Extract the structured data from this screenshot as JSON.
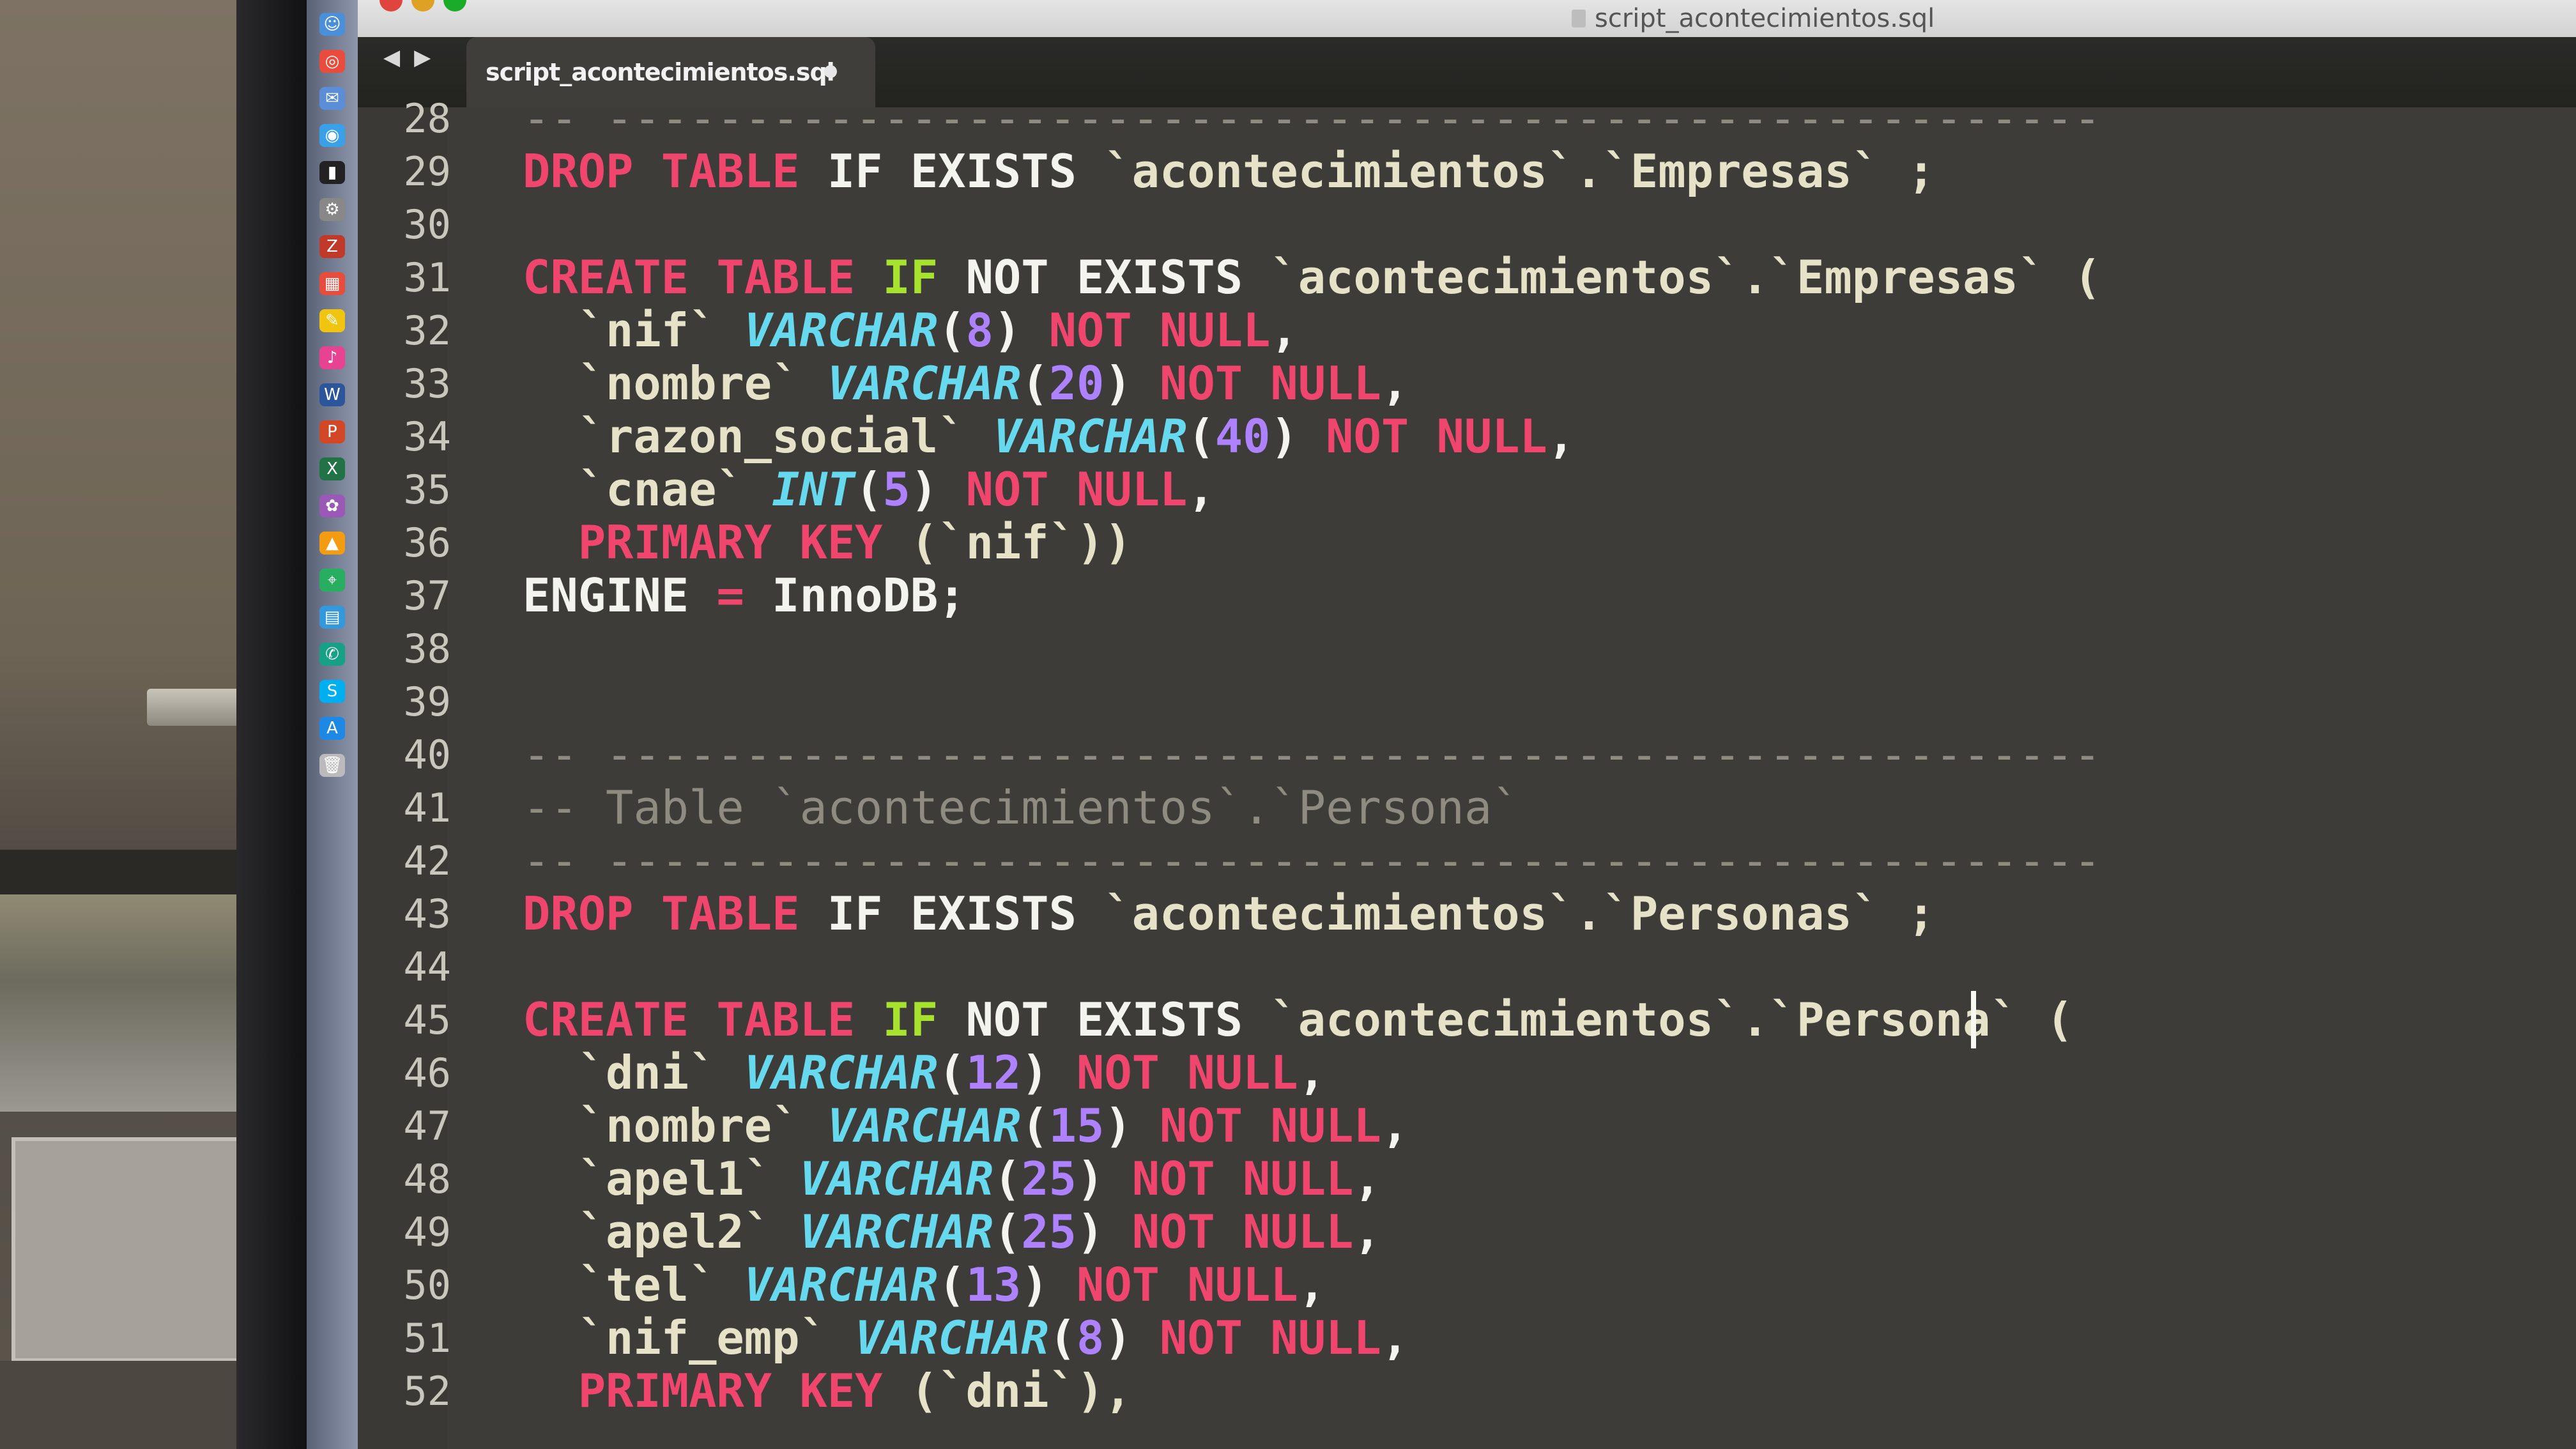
{
  "window": {
    "title": "script_acontecimientos.sql"
  },
  "tabs": [
    {
      "label": "script_acontecimientos.sql",
      "modified": true
    }
  ],
  "nav": {
    "back": "◀",
    "forward": "▶"
  },
  "colors": {
    "keyword_red": "#f0466e",
    "keyword_green": "#a6e22e",
    "type_blue": "#66d9ef",
    "number_purple": "#ae81ff",
    "comment_gray": "#8f8b80",
    "editor_bg": "#3d3c39"
  },
  "dock_icons": [
    "finder-icon",
    "chrome-icon",
    "mail-icon",
    "safari-icon",
    "terminal-icon",
    "settings-icon",
    "filezilla-icon",
    "calendar-icon",
    "notes-icon",
    "music-icon",
    "word-icon",
    "powerpoint-icon",
    "excel-icon",
    "photos-icon",
    "vlc-icon",
    "maps-icon",
    "files-icon",
    "chat-icon",
    "skype-icon",
    "app-store-icon",
    "trash-icon"
  ],
  "code_lines": [
    {
      "num": "28",
      "tokens": [
        {
          "t": "-- ------------------------------------------------------",
          "c": "comment"
        }
      ]
    },
    {
      "num": "29",
      "tokens": [
        {
          "t": "DROP TABLE ",
          "c": "kw-red"
        },
        {
          "t": "IF EXISTS ",
          "c": "kw-white"
        },
        {
          "t": "`acontecimientos`.`Empresas` ;",
          "c": "str-ident"
        }
      ]
    },
    {
      "num": "30",
      "tokens": []
    },
    {
      "num": "31",
      "tokens": [
        {
          "t": "CREATE TABLE ",
          "c": "kw-red"
        },
        {
          "t": "IF ",
          "c": "kw-green"
        },
        {
          "t": "NOT EXISTS ",
          "c": "kw-white"
        },
        {
          "t": "`acontecimientos`.`Empresas` (",
          "c": "str-ident"
        }
      ]
    },
    {
      "num": "32",
      "tokens": [
        {
          "t": "  `nif` ",
          "c": "str-ident"
        },
        {
          "t": "VARCHAR",
          "c": "type-blue"
        },
        {
          "t": "(",
          "c": "kw-white"
        },
        {
          "t": "8",
          "c": "num-purple"
        },
        {
          "t": ") ",
          "c": "kw-white"
        },
        {
          "t": "NOT NULL",
          "c": "kw-red"
        },
        {
          "t": ",",
          "c": "kw-white"
        }
      ]
    },
    {
      "num": "33",
      "tokens": [
        {
          "t": "  `nombre` ",
          "c": "str-ident"
        },
        {
          "t": "VARCHAR",
          "c": "type-blue"
        },
        {
          "t": "(",
          "c": "kw-white"
        },
        {
          "t": "20",
          "c": "num-purple"
        },
        {
          "t": ") ",
          "c": "kw-white"
        },
        {
          "t": "NOT NULL",
          "c": "kw-red"
        },
        {
          "t": ",",
          "c": "kw-white"
        }
      ]
    },
    {
      "num": "34",
      "tokens": [
        {
          "t": "  `razon_social` ",
          "c": "str-ident"
        },
        {
          "t": "VARCHAR",
          "c": "type-blue"
        },
        {
          "t": "(",
          "c": "kw-white"
        },
        {
          "t": "40",
          "c": "num-purple"
        },
        {
          "t": ") ",
          "c": "kw-white"
        },
        {
          "t": "NOT NULL",
          "c": "kw-red"
        },
        {
          "t": ",",
          "c": "kw-white"
        }
      ]
    },
    {
      "num": "35",
      "tokens": [
        {
          "t": "  `cnae` ",
          "c": "str-ident"
        },
        {
          "t": "INT",
          "c": "type-blue"
        },
        {
          "t": "(",
          "c": "kw-white"
        },
        {
          "t": "5",
          "c": "num-purple"
        },
        {
          "t": ") ",
          "c": "kw-white"
        },
        {
          "t": "NOT NULL",
          "c": "kw-red"
        },
        {
          "t": ",",
          "c": "kw-white"
        }
      ]
    },
    {
      "num": "36",
      "tokens": [
        {
          "t": "  PRIMARY KEY ",
          "c": "kw-red"
        },
        {
          "t": "(`nif`))",
          "c": "str-ident"
        }
      ]
    },
    {
      "num": "37",
      "tokens": [
        {
          "t": "ENGINE ",
          "c": "kw-white"
        },
        {
          "t": "= ",
          "c": "kw-red"
        },
        {
          "t": "InnoDB;",
          "c": "kw-white"
        }
      ]
    },
    {
      "num": "38",
      "tokens": []
    },
    {
      "num": "39",
      "tokens": []
    },
    {
      "num": "40",
      "tokens": [
        {
          "t": "-- ------------------------------------------------------",
          "c": "comment"
        }
      ]
    },
    {
      "num": "41",
      "tokens": [
        {
          "t": "-- Table `acontecimientos`.`Persona`",
          "c": "comment"
        }
      ]
    },
    {
      "num": "42",
      "tokens": [
        {
          "t": "-- ------------------------------------------------------",
          "c": "comment"
        }
      ]
    },
    {
      "num": "43",
      "tokens": [
        {
          "t": "DROP TABLE ",
          "c": "kw-red"
        },
        {
          "t": "IF EXISTS ",
          "c": "kw-white"
        },
        {
          "t": "`acontecimientos`.`Personas` ;",
          "c": "str-ident"
        }
      ]
    },
    {
      "num": "44",
      "tokens": []
    },
    {
      "num": "45",
      "tokens": [
        {
          "t": "CREATE TABLE ",
          "c": "kw-red"
        },
        {
          "t": "IF ",
          "c": "kw-green"
        },
        {
          "t": "NOT EXISTS ",
          "c": "kw-white"
        },
        {
          "t": "`acontecimientos`.`Persona` (",
          "c": "str-ident"
        }
      ]
    },
    {
      "num": "46",
      "tokens": [
        {
          "t": "  `dni` ",
          "c": "str-ident"
        },
        {
          "t": "VARCHAR",
          "c": "type-blue"
        },
        {
          "t": "(",
          "c": "kw-white"
        },
        {
          "t": "12",
          "c": "num-purple"
        },
        {
          "t": ") ",
          "c": "kw-white"
        },
        {
          "t": "NOT NULL",
          "c": "kw-red"
        },
        {
          "t": ",",
          "c": "kw-white"
        }
      ]
    },
    {
      "num": "47",
      "tokens": [
        {
          "t": "  `nombre` ",
          "c": "str-ident"
        },
        {
          "t": "VARCHAR",
          "c": "type-blue"
        },
        {
          "t": "(",
          "c": "kw-white"
        },
        {
          "t": "15",
          "c": "num-purple"
        },
        {
          "t": ") ",
          "c": "kw-white"
        },
        {
          "t": "NOT NULL",
          "c": "kw-red"
        },
        {
          "t": ",",
          "c": "kw-white"
        }
      ]
    },
    {
      "num": "48",
      "tokens": [
        {
          "t": "  `apel1` ",
          "c": "str-ident"
        },
        {
          "t": "VARCHAR",
          "c": "type-blue"
        },
        {
          "t": "(",
          "c": "kw-white"
        },
        {
          "t": "25",
          "c": "num-purple"
        },
        {
          "t": ") ",
          "c": "kw-white"
        },
        {
          "t": "NOT NULL",
          "c": "kw-red"
        },
        {
          "t": ",",
          "c": "kw-white"
        }
      ]
    },
    {
      "num": "49",
      "tokens": [
        {
          "t": "  `apel2` ",
          "c": "str-ident"
        },
        {
          "t": "VARCHAR",
          "c": "type-blue"
        },
        {
          "t": "(",
          "c": "kw-white"
        },
        {
          "t": "25",
          "c": "num-purple"
        },
        {
          "t": ") ",
          "c": "kw-white"
        },
        {
          "t": "NOT NULL",
          "c": "kw-red"
        },
        {
          "t": ",",
          "c": "kw-white"
        }
      ]
    },
    {
      "num": "50",
      "tokens": [
        {
          "t": "  `tel` ",
          "c": "str-ident"
        },
        {
          "t": "VARCHAR",
          "c": "type-blue"
        },
        {
          "t": "(",
          "c": "kw-white"
        },
        {
          "t": "13",
          "c": "num-purple"
        },
        {
          "t": ") ",
          "c": "kw-white"
        },
        {
          "t": "NOT NULL",
          "c": "kw-red"
        },
        {
          "t": ",",
          "c": "kw-white"
        }
      ]
    },
    {
      "num": "51",
      "tokens": [
        {
          "t": "  `nif_emp` ",
          "c": "str-ident"
        },
        {
          "t": "VARCHAR",
          "c": "type-blue"
        },
        {
          "t": "(",
          "c": "kw-white"
        },
        {
          "t": "8",
          "c": "num-purple"
        },
        {
          "t": ") ",
          "c": "kw-white"
        },
        {
          "t": "NOT NULL",
          "c": "kw-red"
        },
        {
          "t": ",",
          "c": "kw-white"
        }
      ]
    },
    {
      "num": "52",
      "tokens": [
        {
          "t": "  PRIMARY KEY ",
          "c": "kw-red"
        },
        {
          "t": "(`dni`),",
          "c": "str-ident"
        }
      ]
    }
  ]
}
